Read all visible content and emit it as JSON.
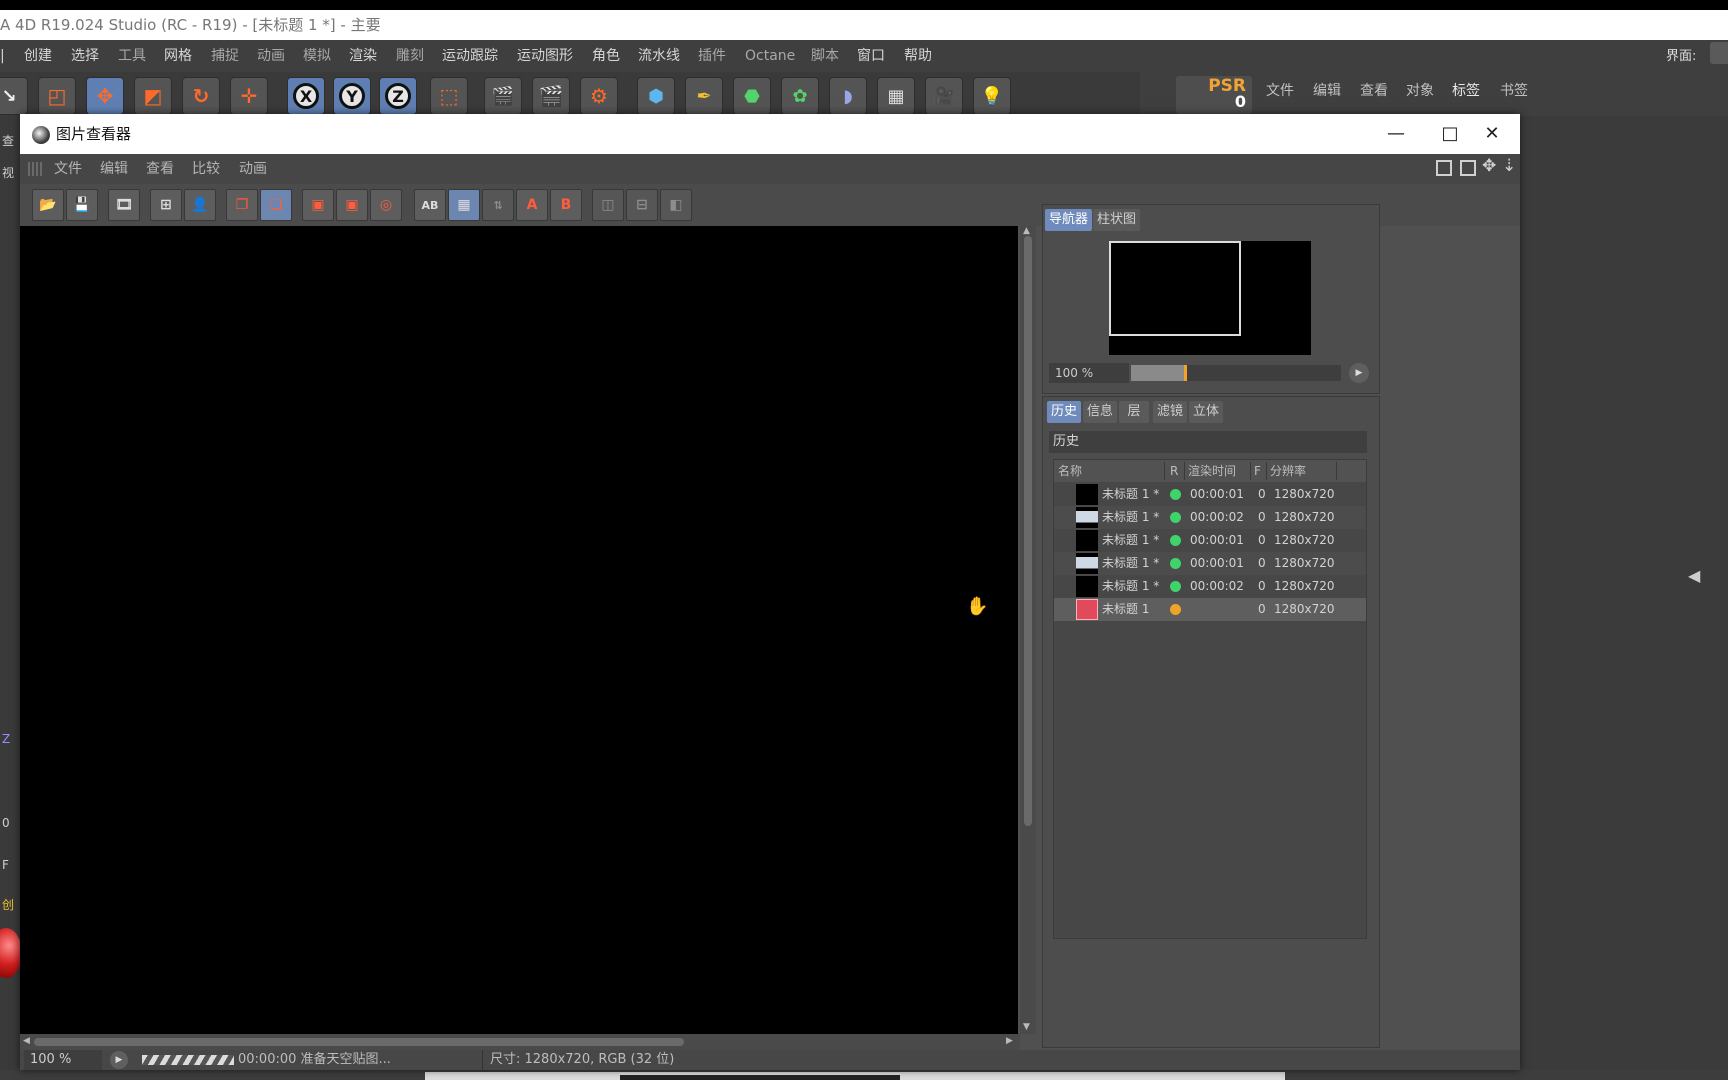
{
  "app": {
    "title": "A 4D R19.024 Studio (RC - R19) - [未标题 1 *] - 主要",
    "menu": [
      "创建",
      "选择",
      "工具",
      "网格",
      "捕捉",
      "动画",
      "模拟",
      "渲染",
      "雕刻",
      "运动跟踪",
      "运动图形",
      "角色",
      "流水线",
      "插件",
      "Octane",
      "脚本",
      "窗口",
      "帮助"
    ],
    "layout_label": "界面:",
    "psr_label": "PSR",
    "psr_value": "0",
    "right_menu": [
      "文件",
      "编辑",
      "查看",
      "对象",
      "标签",
      "书签"
    ],
    "left_markers": [
      "查",
      "视",
      "Z",
      "0",
      "F",
      "创"
    ]
  },
  "viewer": {
    "title": "图片查看器",
    "window_buttons": {
      "minimize": "—",
      "maximize": "□",
      "close": "✕"
    },
    "menu": [
      "文件",
      "编辑",
      "查看",
      "比较",
      "动画"
    ],
    "toolbar_icons": [
      "open-icon",
      "save-icon",
      "render-icon",
      "crop-icon",
      "person-icon",
      "copy-icon",
      "paste-icon",
      "view-a-icon",
      "view-b-icon",
      "compare-icon",
      "ab-icon",
      "grid-icon",
      "ab-swap-icon",
      "set-a-icon",
      "set-b-icon",
      "split-icon",
      "split-h-icon",
      "split-v-icon"
    ],
    "toolbar_labels": {
      "ab": "AB",
      "set_a": "A",
      "set_b": "B"
    },
    "navigator": {
      "tabs": [
        "导航器",
        "柱状图"
      ],
      "zoom": "100 %",
      "slider_fraction": 0.25
    },
    "history": {
      "tabs": [
        "历史",
        "信息",
        "层",
        "滤镜",
        "立体"
      ],
      "title": "历史",
      "columns": [
        "名称",
        "R",
        "渲染时间",
        "F",
        "分辨率"
      ],
      "rows": [
        {
          "name": "未标题 1 *",
          "status": "green",
          "time": "00:00:01",
          "frame": "0",
          "res": "1280x720",
          "thumb": "dark"
        },
        {
          "name": "未标题 1 *",
          "status": "green",
          "time": "00:00:02",
          "frame": "0",
          "res": "1280x720",
          "thumb": "light"
        },
        {
          "name": "未标题 1 *",
          "status": "green",
          "time": "00:00:01",
          "frame": "0",
          "res": "1280x720",
          "thumb": "dark"
        },
        {
          "name": "未标题 1 *",
          "status": "green",
          "time": "00:00:01",
          "frame": "0",
          "res": "1280x720",
          "thumb": "light"
        },
        {
          "name": "未标题 1 *",
          "status": "green",
          "time": "00:00:02",
          "frame": "0",
          "res": "1280x720",
          "thumb": "dark"
        },
        {
          "name": "未标题 1",
          "status": "orange",
          "time": "",
          "frame": "0",
          "res": "1280x720",
          "thumb": "red"
        }
      ]
    },
    "status": {
      "zoom": "100 %",
      "message": "00:00:00 准备天空贴图...",
      "size": "尺寸: 1280x720, RGB (32 位)"
    }
  },
  "colors": {
    "green": "#3fd46a",
    "orange": "#f0a327",
    "accent": "#6e8bbb"
  }
}
